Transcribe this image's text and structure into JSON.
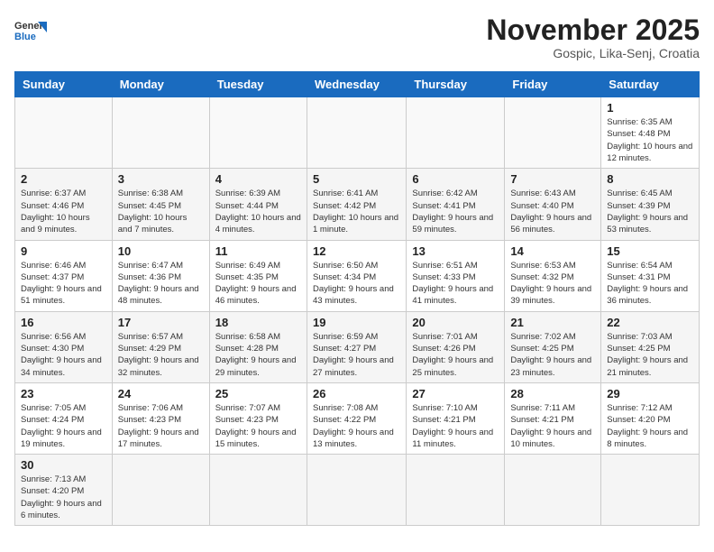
{
  "logo": {
    "text_general": "General",
    "text_blue": "Blue"
  },
  "title": "November 2025",
  "location": "Gospic, Lika-Senj, Croatia",
  "weekdays": [
    "Sunday",
    "Monday",
    "Tuesday",
    "Wednesday",
    "Thursday",
    "Friday",
    "Saturday"
  ],
  "weeks": [
    [
      null,
      null,
      null,
      null,
      null,
      null,
      {
        "day": "1",
        "info": "Sunrise: 6:35 AM\nSunset: 4:48 PM\nDaylight: 10 hours and 12 minutes."
      }
    ],
    [
      {
        "day": "2",
        "info": "Sunrise: 6:37 AM\nSunset: 4:46 PM\nDaylight: 10 hours and 9 minutes."
      },
      {
        "day": "3",
        "info": "Sunrise: 6:38 AM\nSunset: 4:45 PM\nDaylight: 10 hours and 7 minutes."
      },
      {
        "day": "4",
        "info": "Sunrise: 6:39 AM\nSunset: 4:44 PM\nDaylight: 10 hours and 4 minutes."
      },
      {
        "day": "5",
        "info": "Sunrise: 6:41 AM\nSunset: 4:42 PM\nDaylight: 10 hours and 1 minute."
      },
      {
        "day": "6",
        "info": "Sunrise: 6:42 AM\nSunset: 4:41 PM\nDaylight: 9 hours and 59 minutes."
      },
      {
        "day": "7",
        "info": "Sunrise: 6:43 AM\nSunset: 4:40 PM\nDaylight: 9 hours and 56 minutes."
      },
      {
        "day": "8",
        "info": "Sunrise: 6:45 AM\nSunset: 4:39 PM\nDaylight: 9 hours and 53 minutes."
      }
    ],
    [
      {
        "day": "9",
        "info": "Sunrise: 6:46 AM\nSunset: 4:37 PM\nDaylight: 9 hours and 51 minutes."
      },
      {
        "day": "10",
        "info": "Sunrise: 6:47 AM\nSunset: 4:36 PM\nDaylight: 9 hours and 48 minutes."
      },
      {
        "day": "11",
        "info": "Sunrise: 6:49 AM\nSunset: 4:35 PM\nDaylight: 9 hours and 46 minutes."
      },
      {
        "day": "12",
        "info": "Sunrise: 6:50 AM\nSunset: 4:34 PM\nDaylight: 9 hours and 43 minutes."
      },
      {
        "day": "13",
        "info": "Sunrise: 6:51 AM\nSunset: 4:33 PM\nDaylight: 9 hours and 41 minutes."
      },
      {
        "day": "14",
        "info": "Sunrise: 6:53 AM\nSunset: 4:32 PM\nDaylight: 9 hours and 39 minutes."
      },
      {
        "day": "15",
        "info": "Sunrise: 6:54 AM\nSunset: 4:31 PM\nDaylight: 9 hours and 36 minutes."
      }
    ],
    [
      {
        "day": "16",
        "info": "Sunrise: 6:56 AM\nSunset: 4:30 PM\nDaylight: 9 hours and 34 minutes."
      },
      {
        "day": "17",
        "info": "Sunrise: 6:57 AM\nSunset: 4:29 PM\nDaylight: 9 hours and 32 minutes."
      },
      {
        "day": "18",
        "info": "Sunrise: 6:58 AM\nSunset: 4:28 PM\nDaylight: 9 hours and 29 minutes."
      },
      {
        "day": "19",
        "info": "Sunrise: 6:59 AM\nSunset: 4:27 PM\nDaylight: 9 hours and 27 minutes."
      },
      {
        "day": "20",
        "info": "Sunrise: 7:01 AM\nSunset: 4:26 PM\nDaylight: 9 hours and 25 minutes."
      },
      {
        "day": "21",
        "info": "Sunrise: 7:02 AM\nSunset: 4:25 PM\nDaylight: 9 hours and 23 minutes."
      },
      {
        "day": "22",
        "info": "Sunrise: 7:03 AM\nSunset: 4:25 PM\nDaylight: 9 hours and 21 minutes."
      }
    ],
    [
      {
        "day": "23",
        "info": "Sunrise: 7:05 AM\nSunset: 4:24 PM\nDaylight: 9 hours and 19 minutes."
      },
      {
        "day": "24",
        "info": "Sunrise: 7:06 AM\nSunset: 4:23 PM\nDaylight: 9 hours and 17 minutes."
      },
      {
        "day": "25",
        "info": "Sunrise: 7:07 AM\nSunset: 4:23 PM\nDaylight: 9 hours and 15 minutes."
      },
      {
        "day": "26",
        "info": "Sunrise: 7:08 AM\nSunset: 4:22 PM\nDaylight: 9 hours and 13 minutes."
      },
      {
        "day": "27",
        "info": "Sunrise: 7:10 AM\nSunset: 4:21 PM\nDaylight: 9 hours and 11 minutes."
      },
      {
        "day": "28",
        "info": "Sunrise: 7:11 AM\nSunset: 4:21 PM\nDaylight: 9 hours and 10 minutes."
      },
      {
        "day": "29",
        "info": "Sunrise: 7:12 AM\nSunset: 4:20 PM\nDaylight: 9 hours and 8 minutes."
      }
    ],
    [
      {
        "day": "30",
        "info": "Sunrise: 7:13 AM\nSunset: 4:20 PM\nDaylight: 9 hours and 6 minutes."
      },
      null,
      null,
      null,
      null,
      null,
      null
    ]
  ]
}
